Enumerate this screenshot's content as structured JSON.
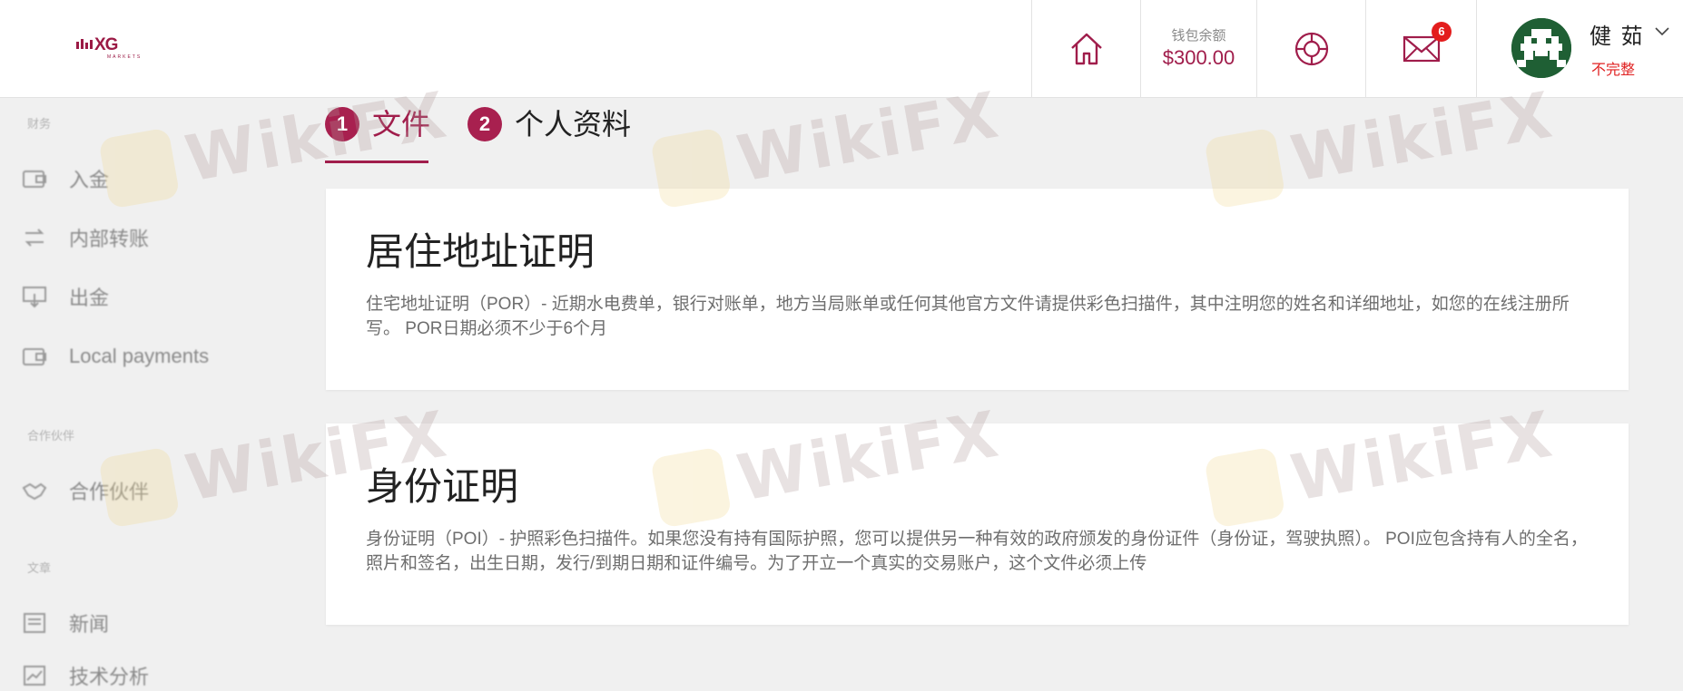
{
  "header": {
    "logo_text": "XG",
    "logo_subtext": "MARKETS",
    "wallet": {
      "label": "钱包余额",
      "value": "$300.00"
    },
    "mail_badge_count": "6",
    "user": {
      "name": "健 茹",
      "status": "不完整"
    },
    "icons": [
      "home-icon",
      "support-lifebuoy-icon",
      "mail-icon",
      "chevron-down-icon"
    ]
  },
  "sidebar": {
    "sections": [
      {
        "title": "财务",
        "items": [
          "入金",
          "内部转账",
          "出金",
          "Local payments"
        ]
      },
      {
        "title": "合作伙伴",
        "items": [
          "合作伙伴"
        ]
      },
      {
        "title": "文章",
        "items": [
          "新闻",
          "技术分析"
        ]
      }
    ]
  },
  "tabs": [
    {
      "number": "1",
      "label": "文件",
      "active": true
    },
    {
      "number": "2",
      "label": "个人资料",
      "active": false
    }
  ],
  "cards": [
    {
      "title": "居住地址证明",
      "description": "住宅地址证明（POR）- 近期水电费单，银行对账单，地方当局账单或任何其他官方文件请提供彩色扫描件，其中注明您的姓名和详细地址，如您的在线注册所写。 POR日期必须不少于6个月"
    },
    {
      "title": "身份证明",
      "description": "身份证明（POI）- 护照彩色扫描件。如果您没有持有国际护照，您可以提供另一种有效的政府颁发的身份证件（身份证，驾驶执照）。 POI应包含持有人的全名，照片和签名，出生日期，发行/到期日期和证件编号。为了开立一个真实的交易账户，这个文件必须上传"
    }
  ],
  "watermark_text": "WikiFX",
  "colors": {
    "brand": "#a01d4b",
    "badge": "#e31d1d",
    "status_incomplete": "#e02020",
    "background": "#f0f0f0"
  }
}
